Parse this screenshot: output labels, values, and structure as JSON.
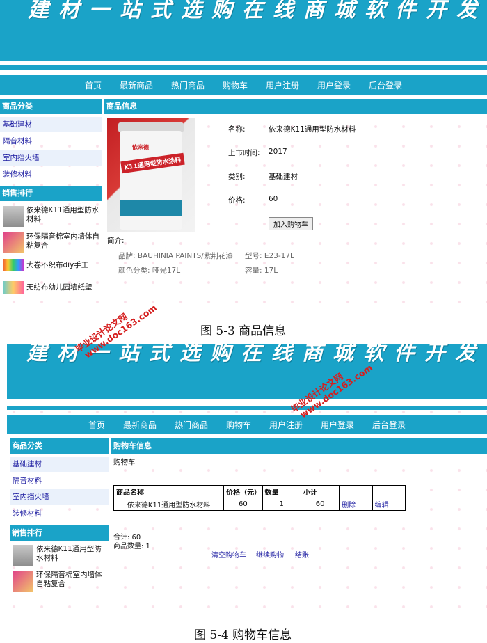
{
  "top": {
    "banner": "建材一站式选购在线商城软件开发",
    "nav": [
      "首页",
      "最新商品",
      "热门商品",
      "购物车",
      "用户注册",
      "用户登录",
      "后台登录"
    ],
    "sidebar": {
      "category_title": "商品分类",
      "categories": [
        "基础建材",
        "隔音材料",
        "室内挡火墙",
        "装修材料"
      ],
      "ranking_title": "销售排行",
      "ranking": [
        "依来德K11通用型防水材料",
        "环保隔音棉室内墙体自粘复合",
        "大卷不织布diy手工",
        "无纺布幼儿园墙纸壁"
      ]
    },
    "product": {
      "section_title": "商品信息",
      "image_text": "K11通用型防水涂料",
      "image_brand": "依来德",
      "name_label": "名称:",
      "name_value": "依来德K11通用型防水材料",
      "date_label": "上市时间:",
      "date_value": "2017",
      "category_label": "类别:",
      "category_value": "基础建材",
      "price_label": "价格:",
      "price_value": "60",
      "add_cart": "加入购物车",
      "intro_label": "简介:",
      "spec_brand": "品牌: BAUHINIA PAINTS/紫荆花漆",
      "spec_model": "型号: E23-17L",
      "spec_color": "颜色分类: 哑光17L",
      "spec_capacity": "容量: 17L"
    },
    "caption": "图 5-3 商品信息"
  },
  "bottom": {
    "banner": "建材一站式选购在线商城软件开发",
    "nav": [
      "首页",
      "最新商品",
      "热门商品",
      "购物车",
      "用户注册",
      "用户登录",
      "后台登录"
    ],
    "sidebar": {
      "category_title": "商品分类",
      "categories": [
        "基础建材",
        "隔音材料",
        "室内挡火墙",
        "装修材料"
      ],
      "ranking_title": "销售排行",
      "ranking": [
        "依来德K11通用型防水材料",
        "环保隔音棉室内墙体自粘复合"
      ]
    },
    "cart": {
      "section_title": "购物车信息",
      "subtitle": "购物车",
      "headers": [
        "商品名称",
        "价格（元）",
        "数量",
        "小计",
        "",
        ""
      ],
      "row": [
        "依来德K11通用型防水材料",
        "60",
        "1",
        "60",
        "删除",
        "编辑"
      ],
      "total": "合计: 60",
      "count": "商品数量: 1",
      "actions": [
        "清空购物车",
        "继续购物",
        "结账"
      ]
    },
    "caption": "图 5-4 购物车信息"
  },
  "watermark": {
    "line1": "毕业设计论文网",
    "line2": "www.doc163.com"
  }
}
